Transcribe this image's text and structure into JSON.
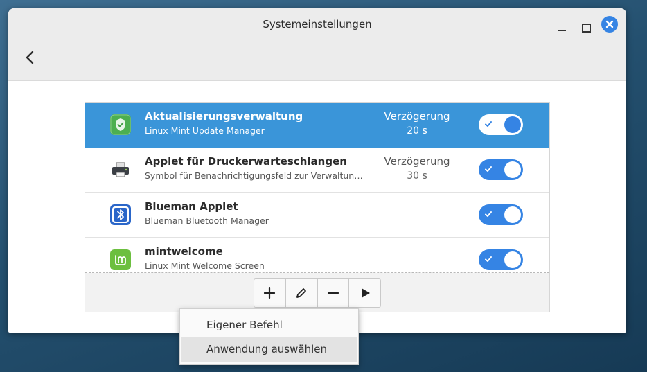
{
  "window": {
    "title": "Systemeinstellungen"
  },
  "startup_list": {
    "items": [
      {
        "name": "Aktualisierungsverwaltung",
        "description": "Linux Mint Update Manager",
        "delay_label": "Verzögerung",
        "delay_value": "20 s",
        "enabled": true,
        "selected": true,
        "icon": "shield-icon"
      },
      {
        "name": "Applet für Druckerwarteschlangen",
        "description": "Symbol für Benachrichtigungsfeld zur Verwaltun…",
        "delay_label": "Verzögerung",
        "delay_value": "30 s",
        "enabled": true,
        "selected": false,
        "icon": "printer-icon"
      },
      {
        "name": "Blueman Applet",
        "description": "Blueman Bluetooth Manager",
        "enabled": true,
        "selected": false,
        "icon": "bluetooth-icon"
      },
      {
        "name": "mintwelcome",
        "description": "Linux Mint Welcome Screen",
        "enabled": true,
        "selected": false,
        "icon": "mint-logo-icon"
      }
    ]
  },
  "toolbar": {
    "buttons": [
      "plus-icon",
      "pencil-icon",
      "minus-icon",
      "play-icon"
    ]
  },
  "add_menu": {
    "items": [
      "Eigener Befehl",
      "Anwendung auswählen"
    ],
    "highlighted_index": 1
  },
  "colors": {
    "accent": "#3584e4",
    "selection": "#3a95d9",
    "titlebar": "#ececec"
  }
}
